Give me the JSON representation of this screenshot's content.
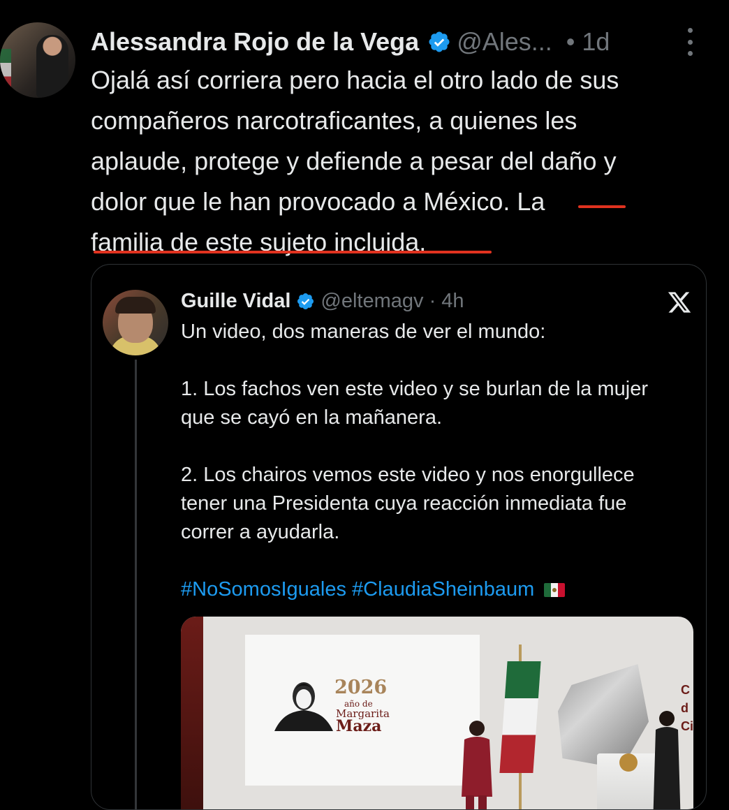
{
  "post": {
    "author_name": "Alessandra Rojo de la Vega",
    "handle": "@Ales...",
    "time": "• 1d",
    "lines": [
      "Ojalá así corriera pero hacia el otro lado de sus",
      "compañeros narcotraficantes, a quienes les",
      "aplaude, protege y defiende a pesar del daño y",
      "dolor que le han provocado a México. La",
      "familia de este sujeto incluida."
    ],
    "verified_icon": "verified-badge-icon",
    "more_icon": "more-vertical-icon"
  },
  "quoted": {
    "author_name": "Guille Vidal",
    "handle": "@eltemagv · 4h",
    "platform_icon": "x-logo-icon",
    "paragraph1": "Un video, dos maneras de ver el mundo:",
    "paragraph2_line1": "1. Los fachos ven este video y se burlan de la mujer",
    "paragraph2_line2": "que se cayó en la mañanera.",
    "paragraph3_line1": "2. Los chairos vemos este video y nos enorgullece",
    "paragraph3_line2": "tener una Presidenta cuya reacción inmediata fue",
    "paragraph3_line3": "correr a ayudarla.",
    "hashtag1": "#NoSomosIguales",
    "hashtag2": "#ClaudiaSheinbaum",
    "flag_emoji": "mexico-flag-emoji",
    "media": {
      "year": "2026",
      "small": "año de",
      "name1": "Margarita",
      "name2": "Maza",
      "edge_text": "C\nd\nCi"
    }
  },
  "colors": {
    "background": "#000000",
    "text": "#e7e9ea",
    "muted": "#71767b",
    "link": "#1d9bf0",
    "verified": "#1d9bf0",
    "underline_mark": "#e0321f"
  }
}
